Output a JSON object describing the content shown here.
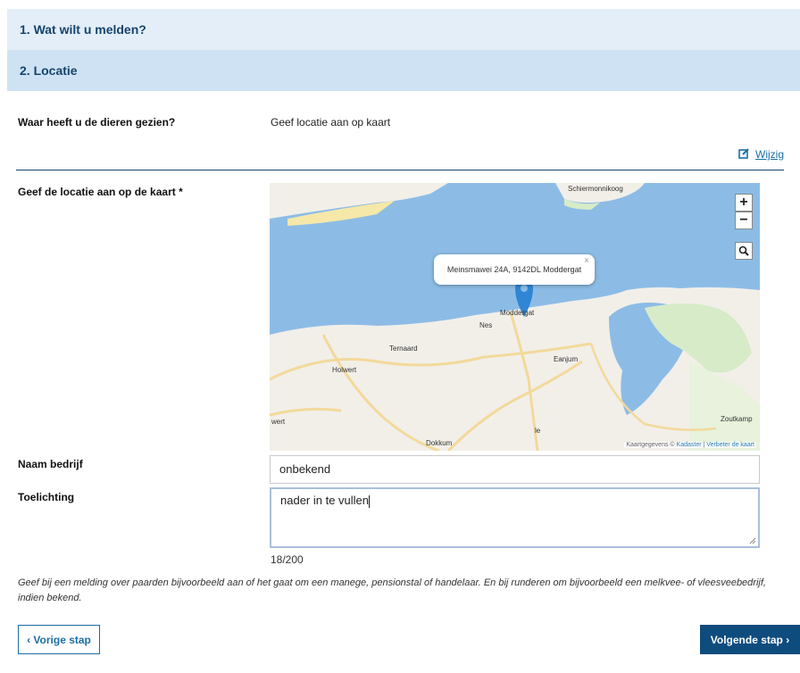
{
  "steps": {
    "step1": "1. Wat wilt u melden?",
    "step2": "2. Locatie"
  },
  "location_question": {
    "label": "Waar heeft u de dieren gezien?",
    "value": "Geef locatie aan op kaart"
  },
  "edit_link": "Wijzig",
  "map_field": {
    "label": "Geef de locatie aan op de kaart *",
    "popup_text": "Meinsmawei 24A, 9142DL Moddergat",
    "popup_close": "×",
    "zoom_in": "+",
    "zoom_out": "−",
    "search_icon": "magnifier-icon",
    "places": {
      "schiermonnikoog": "Schiermonnikoog",
      "moddergat": "Moddergat",
      "nes": "Nes",
      "ternaard": "Ternaard",
      "holwert": "Holwert",
      "eanjum": "Eanjum",
      "wert": "wert",
      "le": "le",
      "zoutkamp": "Zoutkamp",
      "dokkum": "Dokkum"
    },
    "attribution_prefix": "Kaartgegevens ©",
    "attribution_kadaster": "Kadaster",
    "attribution_sep": "|",
    "attribution_improve": "Verbeter de kaart",
    "colors": {
      "sea": "#8cbce6",
      "land": "#f2efe9",
      "road": "#f3d99a",
      "grass": "#d7ebc8",
      "beach": "#f5e8a8",
      "marker": "#2f86d4"
    }
  },
  "company": {
    "label": "Naam bedrijf",
    "value": "onbekend"
  },
  "explanation": {
    "label": "Toelichting",
    "value": "nader in te vullen",
    "counter": "18/200"
  },
  "hint": "Geef bij een melding over paarden bijvoorbeeld aan of het gaat om een manege, pensionstal of handelaar. En bij runderen om bijvoorbeeld een melkvee- of vleesveebedrijf, indien bekend.",
  "buttons": {
    "prev": "‹ Vorige stap",
    "next": "Volgende stap ›"
  }
}
